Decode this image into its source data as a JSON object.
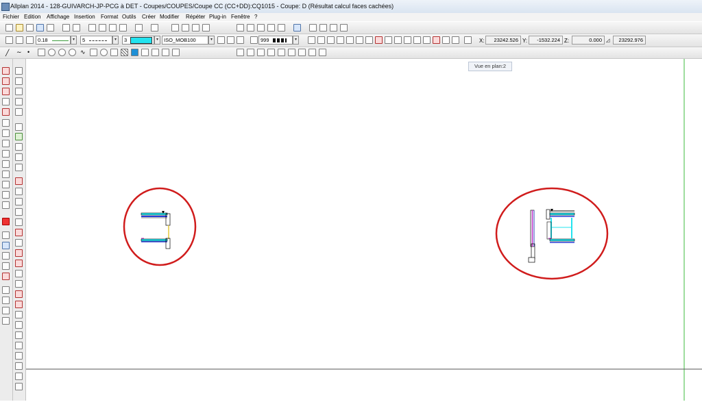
{
  "window": {
    "title": "Allplan 2014 - 128-GUIVARCH-JP-PCG à DET - Coupes/COUPES/Coupe CC (CC+DD):CQ1015 - Coupe: D (Résultat calcul faces cachées)"
  },
  "menu": [
    "Fichier",
    "Edition",
    "Affichage",
    "Insertion",
    "Format",
    "Outils",
    "Créer",
    "Modifier",
    "Répéter",
    "Plug-in",
    "Fenêtre",
    "?"
  ],
  "format_bar": {
    "pen": "0.18",
    "line_type": "5",
    "color_index": "3",
    "color_swatch": "#22e3ef",
    "layer": "ISO_MOB100",
    "pattern_number": "999"
  },
  "coordinates": {
    "x_label": "X:",
    "x": "23242.526",
    "y_label": "Y:",
    "y": "-1532.224",
    "z_label": "Z:",
    "z": "0.000",
    "d": "23292.976"
  },
  "tooltip": "Vue en plan:2",
  "colors": {
    "annotation_circle": "#d01c1c",
    "section_cyan": "#22e3ef",
    "section_blue": "#2a3bd6",
    "section_magenta": "#c026c8",
    "section_yellow": "#e3c52c",
    "guide_green": "#3dbb3d"
  }
}
